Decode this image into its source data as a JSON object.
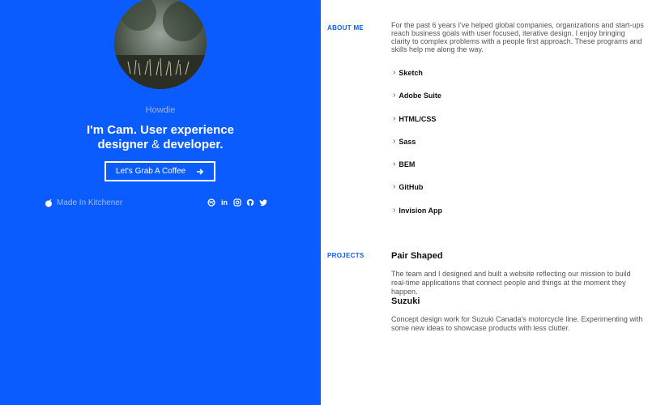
{
  "profile": {
    "greeting": "Howdie",
    "headline_part1": "I'm Cam. User experience",
    "headline_part2": "designer",
    "headline_amp": " & ",
    "headline_part3": "developer.",
    "cta_label": "Let's Grab A Coffee",
    "location": "Made In Kitchener",
    "socials": [
      "dribbble-icon",
      "linkedin-icon",
      "instagram-icon",
      "github-icon",
      "twitter-icon"
    ],
    "socials_linkedin_text": "in"
  },
  "about": {
    "label": "ABOUT ME",
    "text": "For the past 6 years I've helped global companies, organizations and start-ups reach business goals with user focused, iterative design. I enjoy bringing clarity to complex problems with a people first approach. These programs and skills help me along the way.",
    "skills": [
      "Sketch",
      "Adobe Suite",
      "HTML/CSS",
      "Sass",
      "BEM",
      "GitHub",
      "Invision App"
    ]
  },
  "projects": {
    "label": "PROJECTS",
    "items": [
      {
        "title": "Pair Shaped",
        "description": "The team and I designed and built a website reflecting our mission to build real-time applications that connect people and things at the moment they happen."
      },
      {
        "title": "Suzuki",
        "description": "Concept design work for Suzuki Canada's motorcycle line. Experimenting with some new ideas to showcase products with less clutter."
      }
    ]
  },
  "colors": {
    "brand_blue": "#0a5cff",
    "white": "#ffffff"
  }
}
